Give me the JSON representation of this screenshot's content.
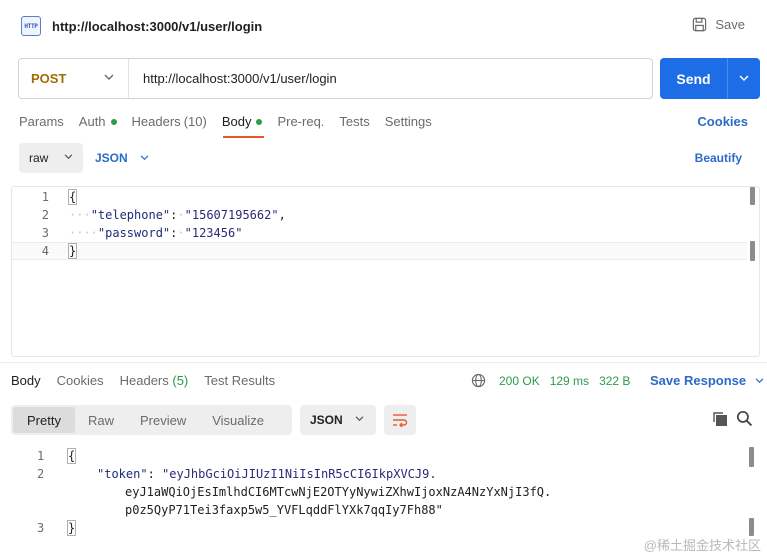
{
  "header": {
    "icon_label": "HTTP",
    "title": "http://localhost:3000/v1/user/login",
    "save_label": "Save"
  },
  "request": {
    "method": "POST",
    "url": "http://localhost:3000/v1/user/login",
    "send_label": "Send"
  },
  "request_tabs": [
    {
      "label": "Params"
    },
    {
      "label": "Auth"
    },
    {
      "label": "Headers",
      "count": "(10)"
    },
    {
      "label": "Body"
    },
    {
      "label": "Pre-req."
    },
    {
      "label": "Tests"
    },
    {
      "label": "Settings"
    }
  ],
  "cookies_label": "Cookies",
  "body_options": {
    "mode": "raw",
    "language": "JSON",
    "beautify_label": "Beautify"
  },
  "request_body": {
    "line_numbers": [
      "1",
      "2",
      "3",
      "4"
    ],
    "open_brace": "{",
    "close_brace": "}",
    "fields": [
      {
        "key": "\"telephone\"",
        "value": "\"15607195662\""
      },
      {
        "key": "\"password\"",
        "value": "\"123456\""
      }
    ]
  },
  "response_tabs": [
    {
      "label": "Body"
    },
    {
      "label": "Cookies"
    },
    {
      "label": "Headers",
      "count": "(5)"
    },
    {
      "label": "Test Results"
    }
  ],
  "response_status": {
    "status": "200 OK",
    "time": "129 ms",
    "size": "322 B",
    "save_response_label": "Save Response"
  },
  "response_view": {
    "modes": [
      "Pretty",
      "Raw",
      "Preview",
      "Visualize"
    ],
    "format": "JSON"
  },
  "response_body": {
    "line_numbers": [
      "1",
      "2",
      "3"
    ],
    "open_brace": "{",
    "close_brace": "}",
    "token_key": "\"token\"",
    "token_value_lines": [
      "\"eyJhbGciOiJIUzI1NiIsInR5cCI6IkpXVCJ9.",
      "eyJ1aWQiOjEsImlhdCI6MTcwNjE2OTYyNywiZXhwIjoxNzA4NzYxNjI3fQ.",
      "p0z5QyP71Tei3faxp5w5_YVFLqddFlYXk7qqIy7Fh88\""
    ]
  },
  "watermark": "@稀土掘金技术社区"
}
